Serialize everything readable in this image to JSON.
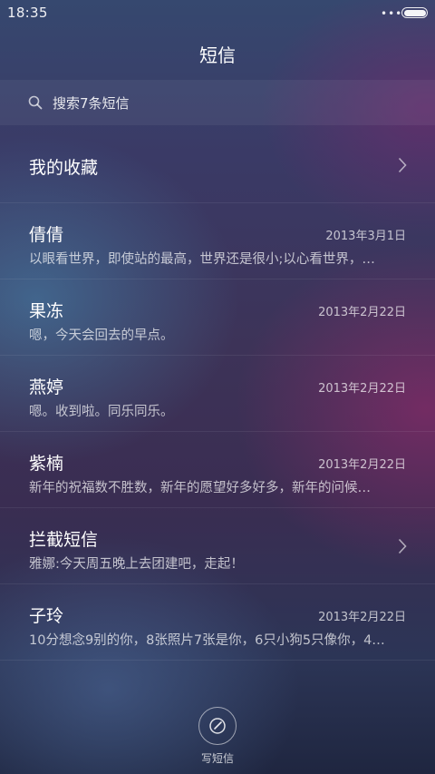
{
  "status_bar": {
    "time": "18:35",
    "more_dots": "•••",
    "battery_level": 1.0
  },
  "header": {
    "title": "短信"
  },
  "search": {
    "placeholder": "搜索7条短信"
  },
  "favorites": {
    "label": "我的收藏"
  },
  "conversations": [
    {
      "name": "倩倩",
      "date": "2013年3月1日",
      "preview": "以眼看世界，即使站的最高，世界还是很小;以心看世界，…"
    },
    {
      "name": "果冻",
      "date": "2013年2月22日",
      "preview": "嗯，今天会回去的早点。"
    },
    {
      "name": "燕婷",
      "date": "2013年2月22日",
      "preview": "嗯。收到啦。同乐同乐。"
    },
    {
      "name": "紫楠",
      "date": "2013年2月22日",
      "preview": "新年的祝福数不胜数，新年的愿望好多好多，新年的问候…"
    },
    {
      "name": "拦截短信",
      "date": "",
      "preview": "雅娜:今天周五晚上去团建吧，走起！"
    },
    {
      "name": "子玲",
      "date": "2013年2月22日",
      "preview": "10分想念9别的你，8张照片7张是你，6只小狗5只像你，4…"
    }
  ],
  "compose": {
    "label": "写短信"
  },
  "icons": {
    "search": "search-icon",
    "chevron": "chevron-right-icon",
    "compose": "compose-pen-icon"
  }
}
